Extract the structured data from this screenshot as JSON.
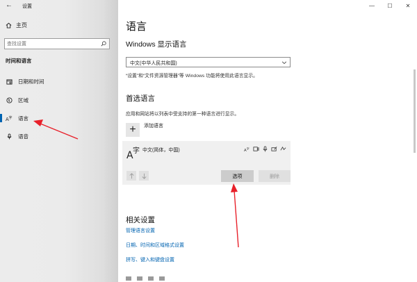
{
  "window": {
    "title": "设置"
  },
  "sidebar": {
    "home": "主页",
    "search_placeholder": "查找设置",
    "section": "时间和语言",
    "items": [
      {
        "label": "日期和时间",
        "icon": "calendar-icon"
      },
      {
        "label": "区域",
        "icon": "globe-icon"
      },
      {
        "label": "语言",
        "icon": "language-icon",
        "selected": true
      },
      {
        "label": "语音",
        "icon": "microphone-icon"
      }
    ]
  },
  "main": {
    "title": "语言",
    "display_language": {
      "heading": "Windows 显示语言",
      "selected": "中文(中华人民共和国)",
      "note": "“设置”和“文件资源管理器”等 Windows 功能将使用此语言显示。"
    },
    "preferred": {
      "heading": "首选语言",
      "note": "应用和网站将以列表中受支持的第一种语言进行显示。",
      "add_label": "添加语言",
      "language": "中文(简体，中国)",
      "options_label": "选项",
      "remove_label": "删除"
    },
    "related": {
      "heading": "相关设置",
      "links": [
        "管理语言设置",
        "日期、时间和区域格式设置",
        "拼写、键入和键盘设置"
      ]
    }
  },
  "colors": {
    "accent": "#0063b1",
    "annotation": "#e8202a"
  }
}
